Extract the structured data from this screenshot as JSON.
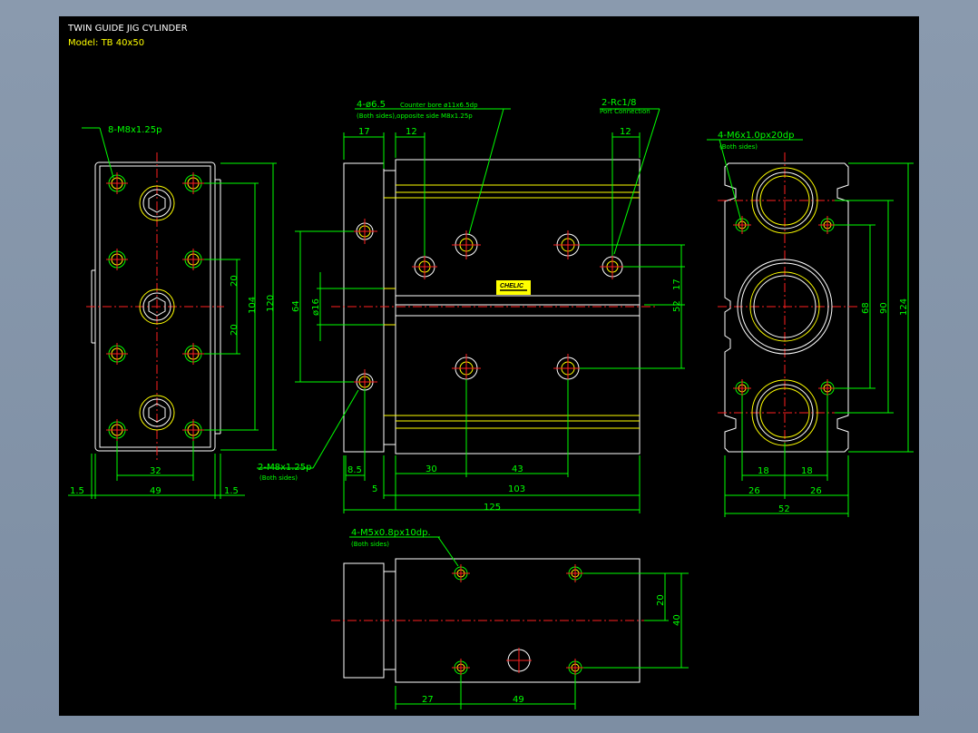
{
  "title": "TWIN GUIDE JIG CYLINDER",
  "model": "Model:  TB 40x50",
  "colors": {
    "background": "#000000",
    "frame": "#7d8ea3",
    "outline": "#ffffff",
    "hidden": "#ffff00",
    "centerline": "#ff2020",
    "dimension": "#00ff00"
  },
  "callouts": {
    "left_top": "8-M8x1.25p",
    "left_bottom": "2-M8x1.25p",
    "left_bottom_note": "(Both sides)",
    "front_bore": "4-ø6.5",
    "front_bore_note": "Counter bore ø11x6.5dp",
    "front_bore_note2": "(Both sides),opposite side M8x1.25p",
    "port": "2-Rc1/8",
    "port_note": "Port Connection",
    "right_top": "4-M6x1.0px20dp",
    "right_top_note": "(Both sides)",
    "bottom_view": "4-M5x0.8px10dp.",
    "bottom_view_note": "(Both sides)"
  },
  "dimensions": {
    "left": {
      "d20a": "20",
      "d20b": "20",
      "d104": "104",
      "d120": "120",
      "d32": "32",
      "d49": "49",
      "d15a": "1.5",
      "d15b": "1.5"
    },
    "front": {
      "d17": "17",
      "d12a": "12",
      "d12b": "12",
      "d64": "64",
      "d16": "ø16",
      "d17b": "17",
      "d52": "52",
      "d85": "8.5",
      "d30": "30",
      "d43": "43",
      "d5": "5",
      "d103": "103",
      "d125": "125"
    },
    "right": {
      "d68": "68",
      "d90": "90",
      "d124": "124",
      "d18a": "18",
      "d18b": "18",
      "d26a": "26",
      "d26b": "26",
      "d52": "52"
    },
    "bottom": {
      "d20": "20",
      "d40": "40",
      "d27": "27",
      "d49": "49"
    }
  },
  "logo": "CHELIC"
}
